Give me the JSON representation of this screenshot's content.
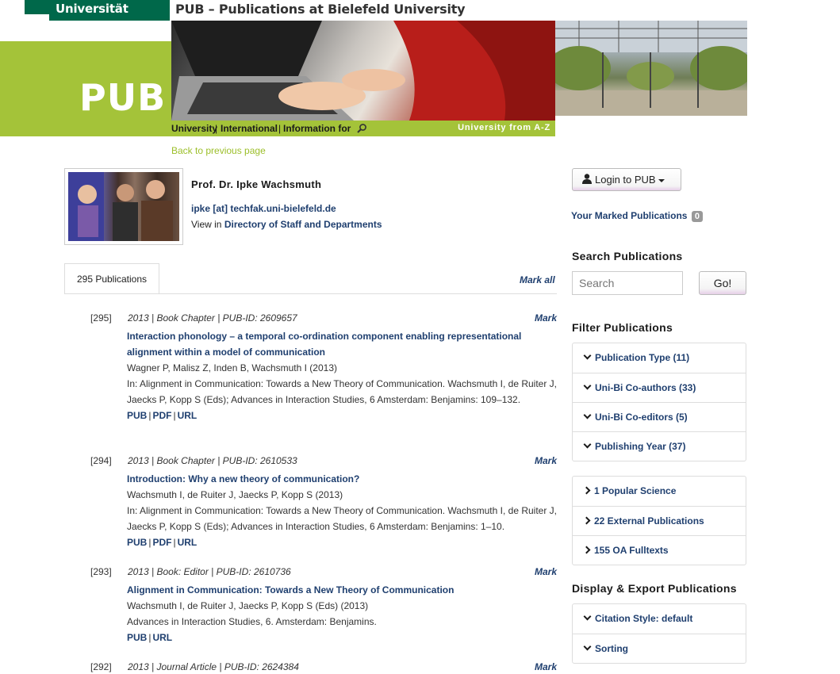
{
  "header": {
    "university": "Universität Bielefeld",
    "site_title": "PUB – Publications at Bielefeld University",
    "logo": "PUB",
    "nav": [
      "University",
      "International",
      "Information for"
    ],
    "atoz": "University from A-Z",
    "back": "Back to previous page"
  },
  "profile": {
    "name": "Prof. Dr. Ipke Wachsmuth",
    "email": "ipke [at] techfak.uni-bielefeld.de",
    "view_in": "View in",
    "directory": "Directory of Staff and Departments"
  },
  "tabs": {
    "publications": "295 Publications",
    "mark_all": "Mark all"
  },
  "publications": [
    {
      "num": "[295]",
      "meta": "2013 | Book Chapter | PUB-ID: 2609657",
      "mark": "Mark",
      "title": "Interaction phonology – a temporal co-ordination component enabling representational alignment within a model of communication",
      "authors": "Wagner P, Malisz Z, Inden B, Wachsmuth I (2013)",
      "source": "In: Alignment in Communication: Towards a New Theory of Communication. Wachsmuth I, de Ruiter J, Jaecks P, Kopp S (Eds); Advances in Interaction Studies, 6 Amsterdam: Benjamins: 109–132.",
      "links": [
        "PUB",
        "PDF",
        "URL"
      ]
    },
    {
      "num": "[294]",
      "meta": "2013 | Book Chapter | PUB-ID: 2610533",
      "mark": "Mark",
      "title": "Introduction: Why a new theory of communication?",
      "authors": "Wachsmuth I, de Ruiter J, Jaecks P, Kopp S (2013)",
      "source": "In: Alignment in Communication: Towards a New Theory of Communication. Wachsmuth I, de Ruiter J, Jaecks P, Kopp S (Eds); Advances in Interaction Studies, 6 Amsterdam: Benjamins: 1–10.",
      "links": [
        "PUB",
        "PDF",
        "URL"
      ]
    },
    {
      "num": "[293]",
      "meta": "2013 | Book: Editor | PUB-ID: 2610736",
      "mark": "Mark",
      "title": "Alignment in Communication: Towards a New Theory of Communication",
      "authors": "Wachsmuth I, de Ruiter J, Jaecks P, Kopp S (Eds) (2013)",
      "source": "Advances in Interaction Studies, 6. Amsterdam: Benjamins.",
      "links": [
        "PUB",
        "URL"
      ]
    },
    {
      "num": "[292]",
      "meta": "2013 | Journal Article | PUB-ID: 2624384",
      "mark": "Mark"
    }
  ],
  "sidebar": {
    "login": "Login to PUB",
    "marked_label": "Your Marked Publications",
    "marked_count": "0",
    "search_heading": "Search Publications",
    "search_placeholder": "Search",
    "go": "Go!",
    "filter_heading": "Filter Publications",
    "filters": [
      "Publication Type (11)",
      "Uni-Bi Co-authors (33)",
      "Uni-Bi Co-editors (5)",
      "Publishing Year (37)"
    ],
    "extras": [
      "1 Popular Science",
      "22 External Publications",
      "155 OA Fulltexts"
    ],
    "display_heading": "Display & Export Publications",
    "display": [
      "Citation Style: default",
      "Sorting"
    ]
  }
}
